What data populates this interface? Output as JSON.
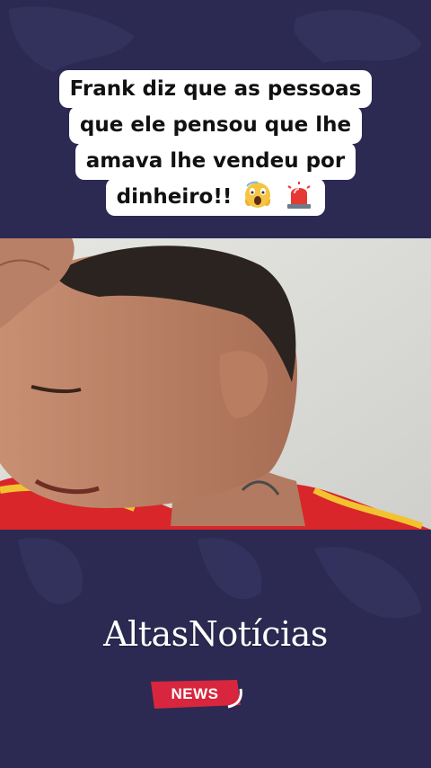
{
  "caption": {
    "lines": [
      "Frank diz que as pessoas",
      "que ele pensou que lhe",
      "amava lhe vendeu por",
      "dinheiro!!"
    ],
    "emojis": [
      "screaming-face-icon",
      "police-light-icon"
    ]
  },
  "brand": {
    "name": "AltasNotícias",
    "badge": "NEWS"
  },
  "colors": {
    "background": "#2c2a52",
    "badge_red": "#d7263d",
    "caption_bg": "#ffffff"
  }
}
